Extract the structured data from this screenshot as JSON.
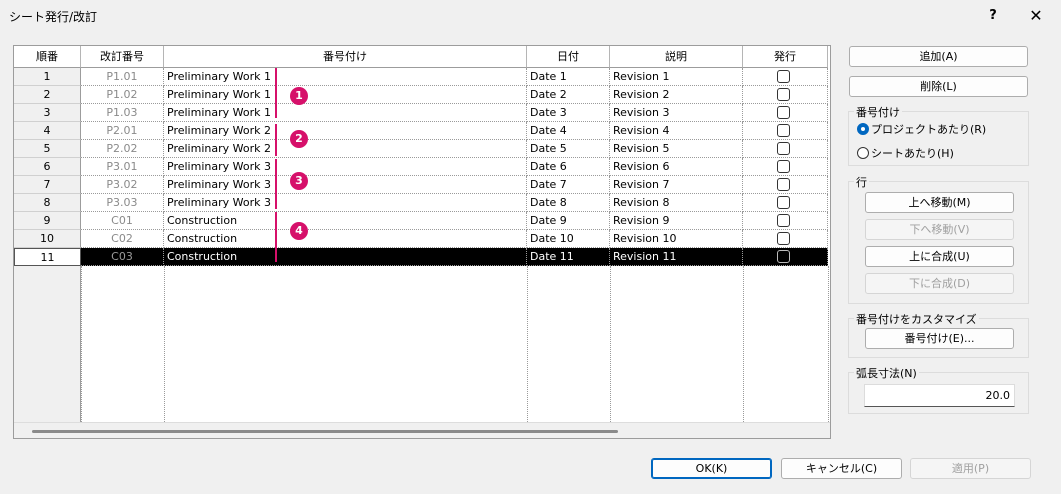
{
  "window": {
    "title": "シート発行/改訂",
    "help_label": "?",
    "close_label": "✕"
  },
  "table": {
    "headers": {
      "row": "順番",
      "revision_number": "改訂番号",
      "numbering": "番号付け",
      "date": "日付",
      "description": "説明",
      "issued": "発行"
    },
    "rows": [
      {
        "seq": "1",
        "rev": "P1.01",
        "numbering": "Preliminary Work 1",
        "date": "Date 1",
        "desc": "Revision 1"
      },
      {
        "seq": "2",
        "rev": "P1.02",
        "numbering": "Preliminary Work 1",
        "date": "Date 2",
        "desc": "Revision 2"
      },
      {
        "seq": "3",
        "rev": "P1.03",
        "numbering": "Preliminary Work 1",
        "date": "Date 3",
        "desc": "Revision 3"
      },
      {
        "seq": "4",
        "rev": "P2.01",
        "numbering": "Preliminary Work 2",
        "date": "Date 4",
        "desc": "Revision 4"
      },
      {
        "seq": "5",
        "rev": "P2.02",
        "numbering": "Preliminary Work 2",
        "date": "Date 5",
        "desc": "Revision 5"
      },
      {
        "seq": "6",
        "rev": "P3.01",
        "numbering": "Preliminary Work 3",
        "date": "Date 6",
        "desc": "Revision 6"
      },
      {
        "seq": "7",
        "rev": "P3.02",
        "numbering": "Preliminary Work 3",
        "date": "Date 7",
        "desc": "Revision 7"
      },
      {
        "seq": "8",
        "rev": "P3.03",
        "numbering": "Preliminary Work 3",
        "date": "Date 8",
        "desc": "Revision 8"
      },
      {
        "seq": "9",
        "rev": "C01",
        "numbering": "Construction",
        "date": "Date 9",
        "desc": "Revision 9"
      },
      {
        "seq": "10",
        "rev": "C02",
        "numbering": "Construction",
        "date": "Date 10",
        "desc": "Revision 10"
      },
      {
        "seq": "11",
        "rev": "C03",
        "numbering": "Construction",
        "date": "Date 11",
        "desc": "Revision 11"
      }
    ],
    "selected_row": "11"
  },
  "annotations": {
    "badge1": "1",
    "badge2": "2",
    "badge3": "3",
    "badge4": "4",
    "color": "#d6106a"
  },
  "side": {
    "add_label": "追加(A)",
    "delete_label": "削除(L)",
    "numbering_group": "番号付け",
    "per_project_label": "プロジェクトあたり(R)",
    "per_sheet_label": "シートあたり(H)",
    "selected_numbering": "per_project",
    "row_group": "行",
    "move_up_label": "上へ移動(M)",
    "move_down_label": "下へ移動(V)",
    "merge_up_label": "上に合成(U)",
    "merge_down_label": "下に合成(D)",
    "customize_group": "番号付けをカスタマイズ",
    "numbering_button_label": "番号付け(E)...",
    "arc_group": "弧長寸法(N)",
    "arc_value": "20.0"
  },
  "footer": {
    "ok_label": "OK(K)",
    "cancel_label": "キャンセル(C)",
    "apply_label": "適用(P)"
  },
  "colors": {
    "accent": "#0067c0",
    "selection": "#000000",
    "background": "#f0f0f0"
  }
}
